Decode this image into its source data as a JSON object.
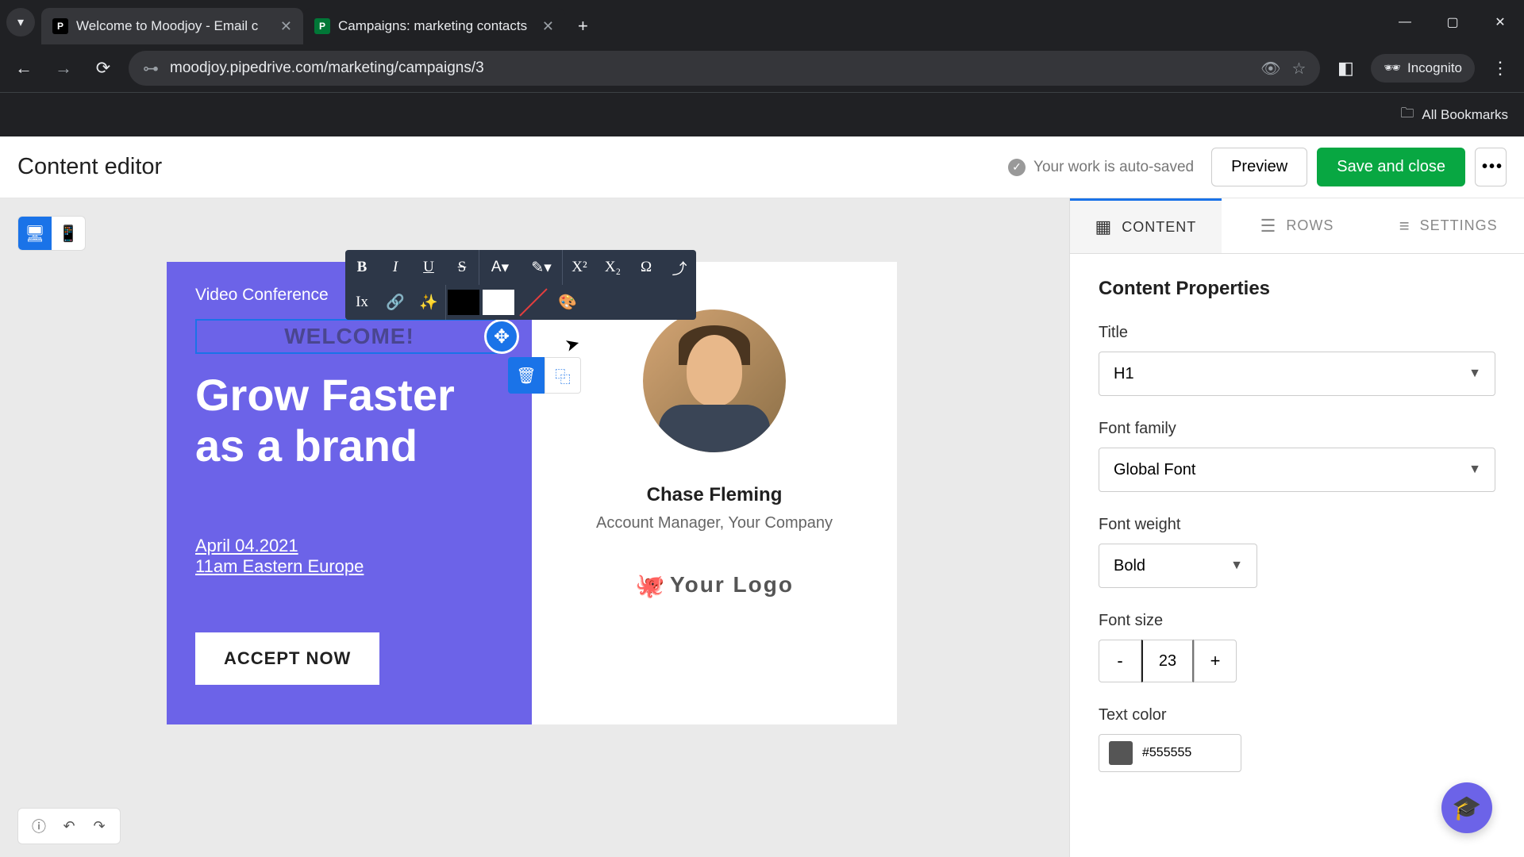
{
  "browser": {
    "tabs": [
      {
        "title": "Welcome to Moodjoy - Email c",
        "favicon": "P"
      },
      {
        "title": "Campaigns: marketing contacts",
        "favicon": "P"
      }
    ],
    "url": "moodjoy.pipedrive.com/marketing/campaigns/3",
    "incognito_label": "Incognito",
    "bookmarks_label": "All Bookmarks"
  },
  "header": {
    "title": "Content editor",
    "autosave": "Your work is auto-saved",
    "preview": "Preview",
    "save": "Save and close",
    "more": "•••"
  },
  "toolbar": {
    "bold": "B",
    "italic": "I",
    "underline": "U",
    "strike": "S",
    "fontcolor": "A",
    "highlight": "✎",
    "superscript": "X²",
    "subscript": "X₂",
    "special": "Ω",
    "upload": "⤴",
    "clearfmt": "Ix",
    "link": "🔗",
    "magic": "✨",
    "palette": "🎨"
  },
  "email": {
    "vc_label": "Video Conference",
    "welcome": "WELCOME!",
    "headline1": "Grow Faster",
    "headline2": "as a brand",
    "date": "April 04.2021",
    "time": "11am Eastern Europe",
    "accept": "ACCEPT NOW",
    "person_name": "Chase Fleming",
    "person_title": "Account Manager, Your Company",
    "logo_text": "Your Logo"
  },
  "sidebar": {
    "tabs": {
      "content": "CONTENT",
      "rows": "ROWS",
      "settings": "SETTINGS"
    },
    "panel_title": "Content Properties",
    "title_label": "Title",
    "title_value": "H1",
    "font_family_label": "Font family",
    "font_family_value": "Global Font",
    "font_weight_label": "Font weight",
    "font_weight_value": "Bold",
    "font_size_label": "Font size",
    "font_size_value": "23",
    "text_color_label": "Text color",
    "text_color_value": "#555555"
  }
}
